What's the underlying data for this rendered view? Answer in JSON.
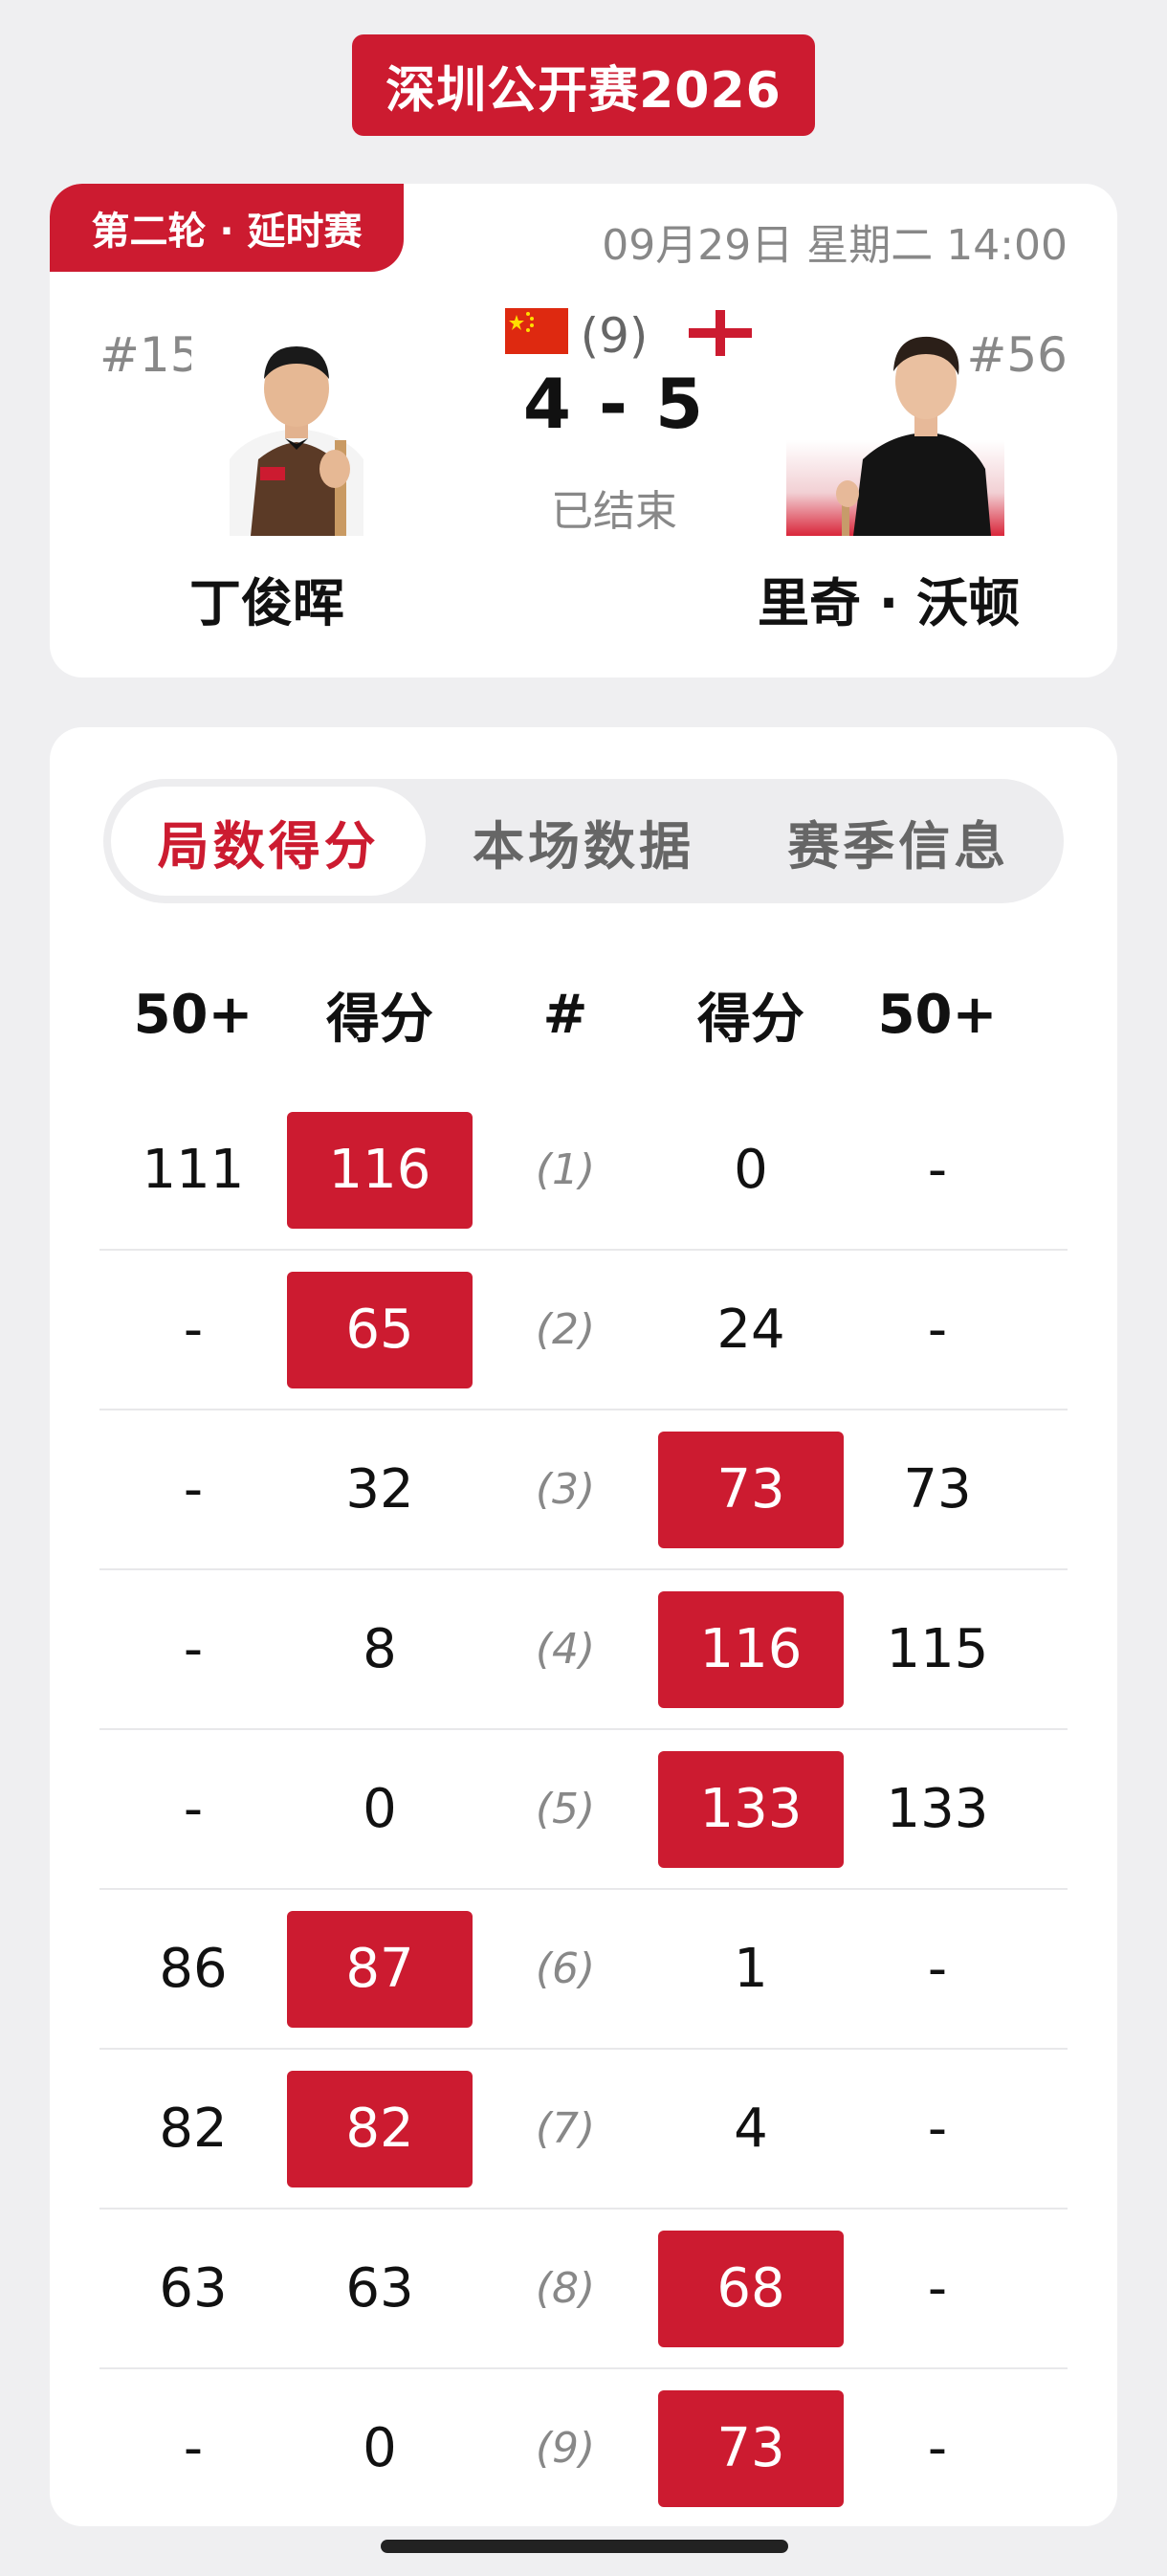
{
  "tournament": "深圳公开赛2026",
  "match": {
    "round": "第二轮 · 延时赛",
    "datetime": "09月29日 星期二 14:00",
    "left": {
      "seed": "#15",
      "name": "丁俊晖",
      "flag": "china-flag-icon"
    },
    "right": {
      "seed": "#56",
      "name": "里奇 · 沃顿",
      "flag": "england-flag-icon"
    },
    "frames_total": "(9)",
    "score": "4 - 5",
    "status": "已结束"
  },
  "tabs": [
    {
      "label": "局数得分",
      "active": true
    },
    {
      "label": "本场数据",
      "active": false
    },
    {
      "label": "赛季信息",
      "active": false
    }
  ],
  "table": {
    "headers": [
      "50+",
      "得分",
      "#",
      "得分",
      "50+"
    ],
    "rows": [
      {
        "l50": "111",
        "lscore": "116",
        "frame": "(1)",
        "rscore": "0",
        "r50": "-",
        "winner": "left"
      },
      {
        "l50": "-",
        "lscore": "65",
        "frame": "(2)",
        "rscore": "24",
        "r50": "-",
        "winner": "left"
      },
      {
        "l50": "-",
        "lscore": "32",
        "frame": "(3)",
        "rscore": "73",
        "r50": "73",
        "winner": "right"
      },
      {
        "l50": "-",
        "lscore": "8",
        "frame": "(4)",
        "rscore": "116",
        "r50": "115",
        "winner": "right"
      },
      {
        "l50": "-",
        "lscore": "0",
        "frame": "(5)",
        "rscore": "133",
        "r50": "133",
        "winner": "right"
      },
      {
        "l50": "86",
        "lscore": "87",
        "frame": "(6)",
        "rscore": "1",
        "r50": "-",
        "winner": "left"
      },
      {
        "l50": "82",
        "lscore": "82",
        "frame": "(7)",
        "rscore": "4",
        "r50": "-",
        "winner": "left"
      },
      {
        "l50": "63",
        "lscore": "63",
        "frame": "(8)",
        "rscore": "68",
        "r50": "-",
        "winner": "right"
      },
      {
        "l50": "-",
        "lscore": "0",
        "frame": "(9)",
        "rscore": "73",
        "r50": "-",
        "winner": "right"
      }
    ]
  },
  "colors": {
    "accent": "#cc1b30",
    "background": "#efeff1",
    "muted": "#888888"
  }
}
